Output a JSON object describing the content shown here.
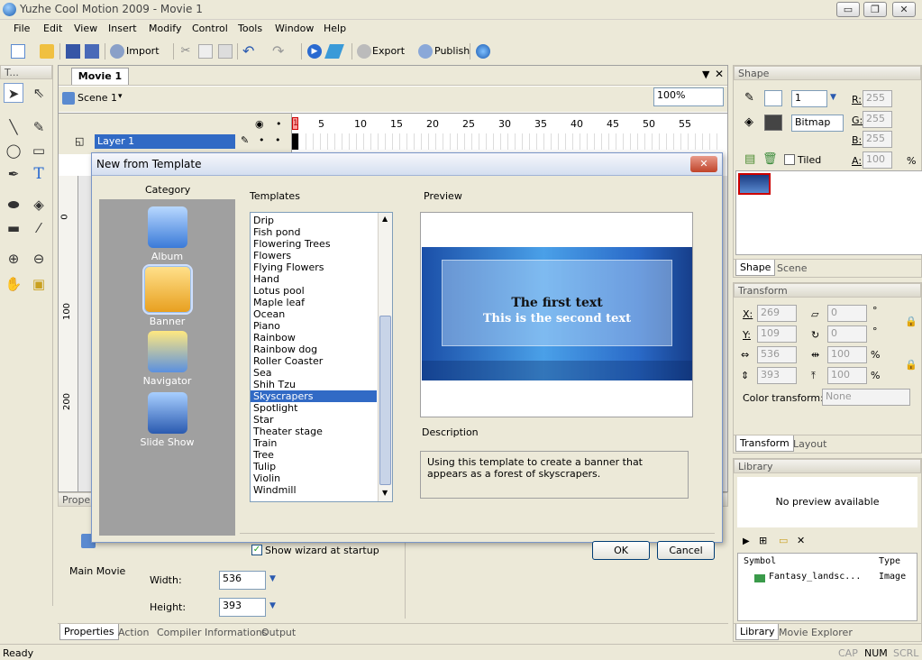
{
  "window": {
    "title": "Yuzhe Cool Motion 2009 - Movie 1",
    "minimize": "▭",
    "restore": "❐",
    "close": "✕"
  },
  "menu": [
    "File",
    "Edit",
    "View",
    "Insert",
    "Modify",
    "Control",
    "Tools",
    "Window",
    "Help"
  ],
  "toolbar": {
    "import": "Import",
    "export": "Export",
    "publish": "Publish"
  },
  "tools_panel": {
    "title": "T..."
  },
  "document": {
    "tab": "Movie 1",
    "scene": "Scene 1",
    "zoom": "100%",
    "layer": "Layer 1",
    "frame_current": "1",
    "frame_ticks": [
      "5",
      "10",
      "15",
      "20",
      "25",
      "30",
      "35",
      "40",
      "45",
      "50",
      "55"
    ],
    "ruler": [
      "0",
      "100",
      "200"
    ]
  },
  "properties": {
    "header": "Proper",
    "main_movie": "Main Movie",
    "width_label": "Width:",
    "width_value": "536",
    "height_label": "Height:",
    "height_value": "393"
  },
  "bottom_tabs": [
    "Properties",
    "Action",
    "Compiler Informations",
    "Output"
  ],
  "shape_panel": {
    "title": "Shape",
    "stroke_width": "1",
    "fill_type": "Bitmap",
    "r_label": "R:",
    "g_label": "G:",
    "b_label": "B:",
    "a_label": "A:",
    "r": "255",
    "g": "255",
    "b": "255",
    "a": "100",
    "a_unit": "%",
    "tiled": "Tiled",
    "tabs": [
      "Shape",
      "Scene"
    ]
  },
  "transform_panel": {
    "title": "Transform",
    "x_label": "X:",
    "y_label": "Y:",
    "x": "269",
    "y": "109",
    "w": "536",
    "h": "393",
    "rot1": "0",
    "rot2": "0",
    "deg": "°",
    "sx": "100",
    "sy": "100",
    "pct": "%",
    "color_transform_label": "Color transform:",
    "color_transform": "None",
    "tabs": [
      "Transform",
      "Layout"
    ]
  },
  "library_panel": {
    "title": "Library",
    "preview": "No preview available",
    "col_symbol": "Symbol",
    "col_type": "Type",
    "row_symbol": "Fantasy_landsc...",
    "row_type": "Image",
    "tabs": [
      "Library",
      "Movie Explorer"
    ]
  },
  "dialog": {
    "title": "New from Template",
    "category_label": "Category",
    "categories": [
      {
        "name": "Album"
      },
      {
        "name": "Banner"
      },
      {
        "name": "Navigator"
      },
      {
        "name": "Slide Show"
      }
    ],
    "selected_category": "Banner",
    "templates_label": "Templates",
    "templates": [
      "Drip",
      "Fish pond",
      "Flowering Trees",
      "Flowers",
      "Flying Flowers",
      "Hand",
      "Lotus pool",
      "Maple leaf",
      "Ocean",
      "Piano",
      "Rainbow",
      "Rainbow dog",
      "Roller Coaster",
      "Sea",
      "Shih Tzu",
      "Skyscrapers",
      "Spotlight",
      "Star",
      "Theater stage",
      "Train",
      "Tree",
      "Tulip",
      "Violin",
      "Windmill"
    ],
    "selected_template": "Skyscrapers",
    "preview_label": "Preview",
    "preview_text1": "The first text",
    "preview_text2": "This is the second text",
    "description_label": "Description",
    "description": "Using this template to create a banner that appears as a forest of skyscrapers.",
    "show_wizard": "Show wizard at startup",
    "ok": "OK",
    "cancel": "Cancel"
  },
  "status": {
    "left": "Ready",
    "cap": "CAP",
    "num": "NUM",
    "scrl": "SCRL"
  },
  "colors": {
    "selection": "#316ac5",
    "dialog_border": "#7a96c8",
    "banner_blue": "#2a78d0"
  }
}
